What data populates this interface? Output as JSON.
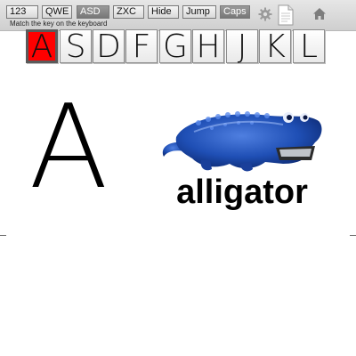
{
  "toolbar": {
    "buttons": [
      {
        "label": "123",
        "active": false
      },
      {
        "label": "QWE",
        "active": false
      },
      {
        "label": "ASD",
        "active": true
      },
      {
        "label": "ZXC",
        "active": false
      },
      {
        "label": "Hide",
        "active": false
      },
      {
        "label": "Jump",
        "active": false
      },
      {
        "label": "Caps",
        "active": true
      }
    ],
    "hint": "Match the key on the keyboard",
    "icons": [
      "gear-icon",
      "document-icon",
      "home-icon"
    ]
  },
  "keyboard": {
    "keys": [
      "A",
      "S",
      "D",
      "F",
      "G",
      "H",
      "J",
      "K",
      "L"
    ],
    "highlighted": "A",
    "highlight_color": "#ff0000"
  },
  "card": {
    "letter": "A",
    "word": "alligator",
    "image": "blue-alligator-toy"
  }
}
